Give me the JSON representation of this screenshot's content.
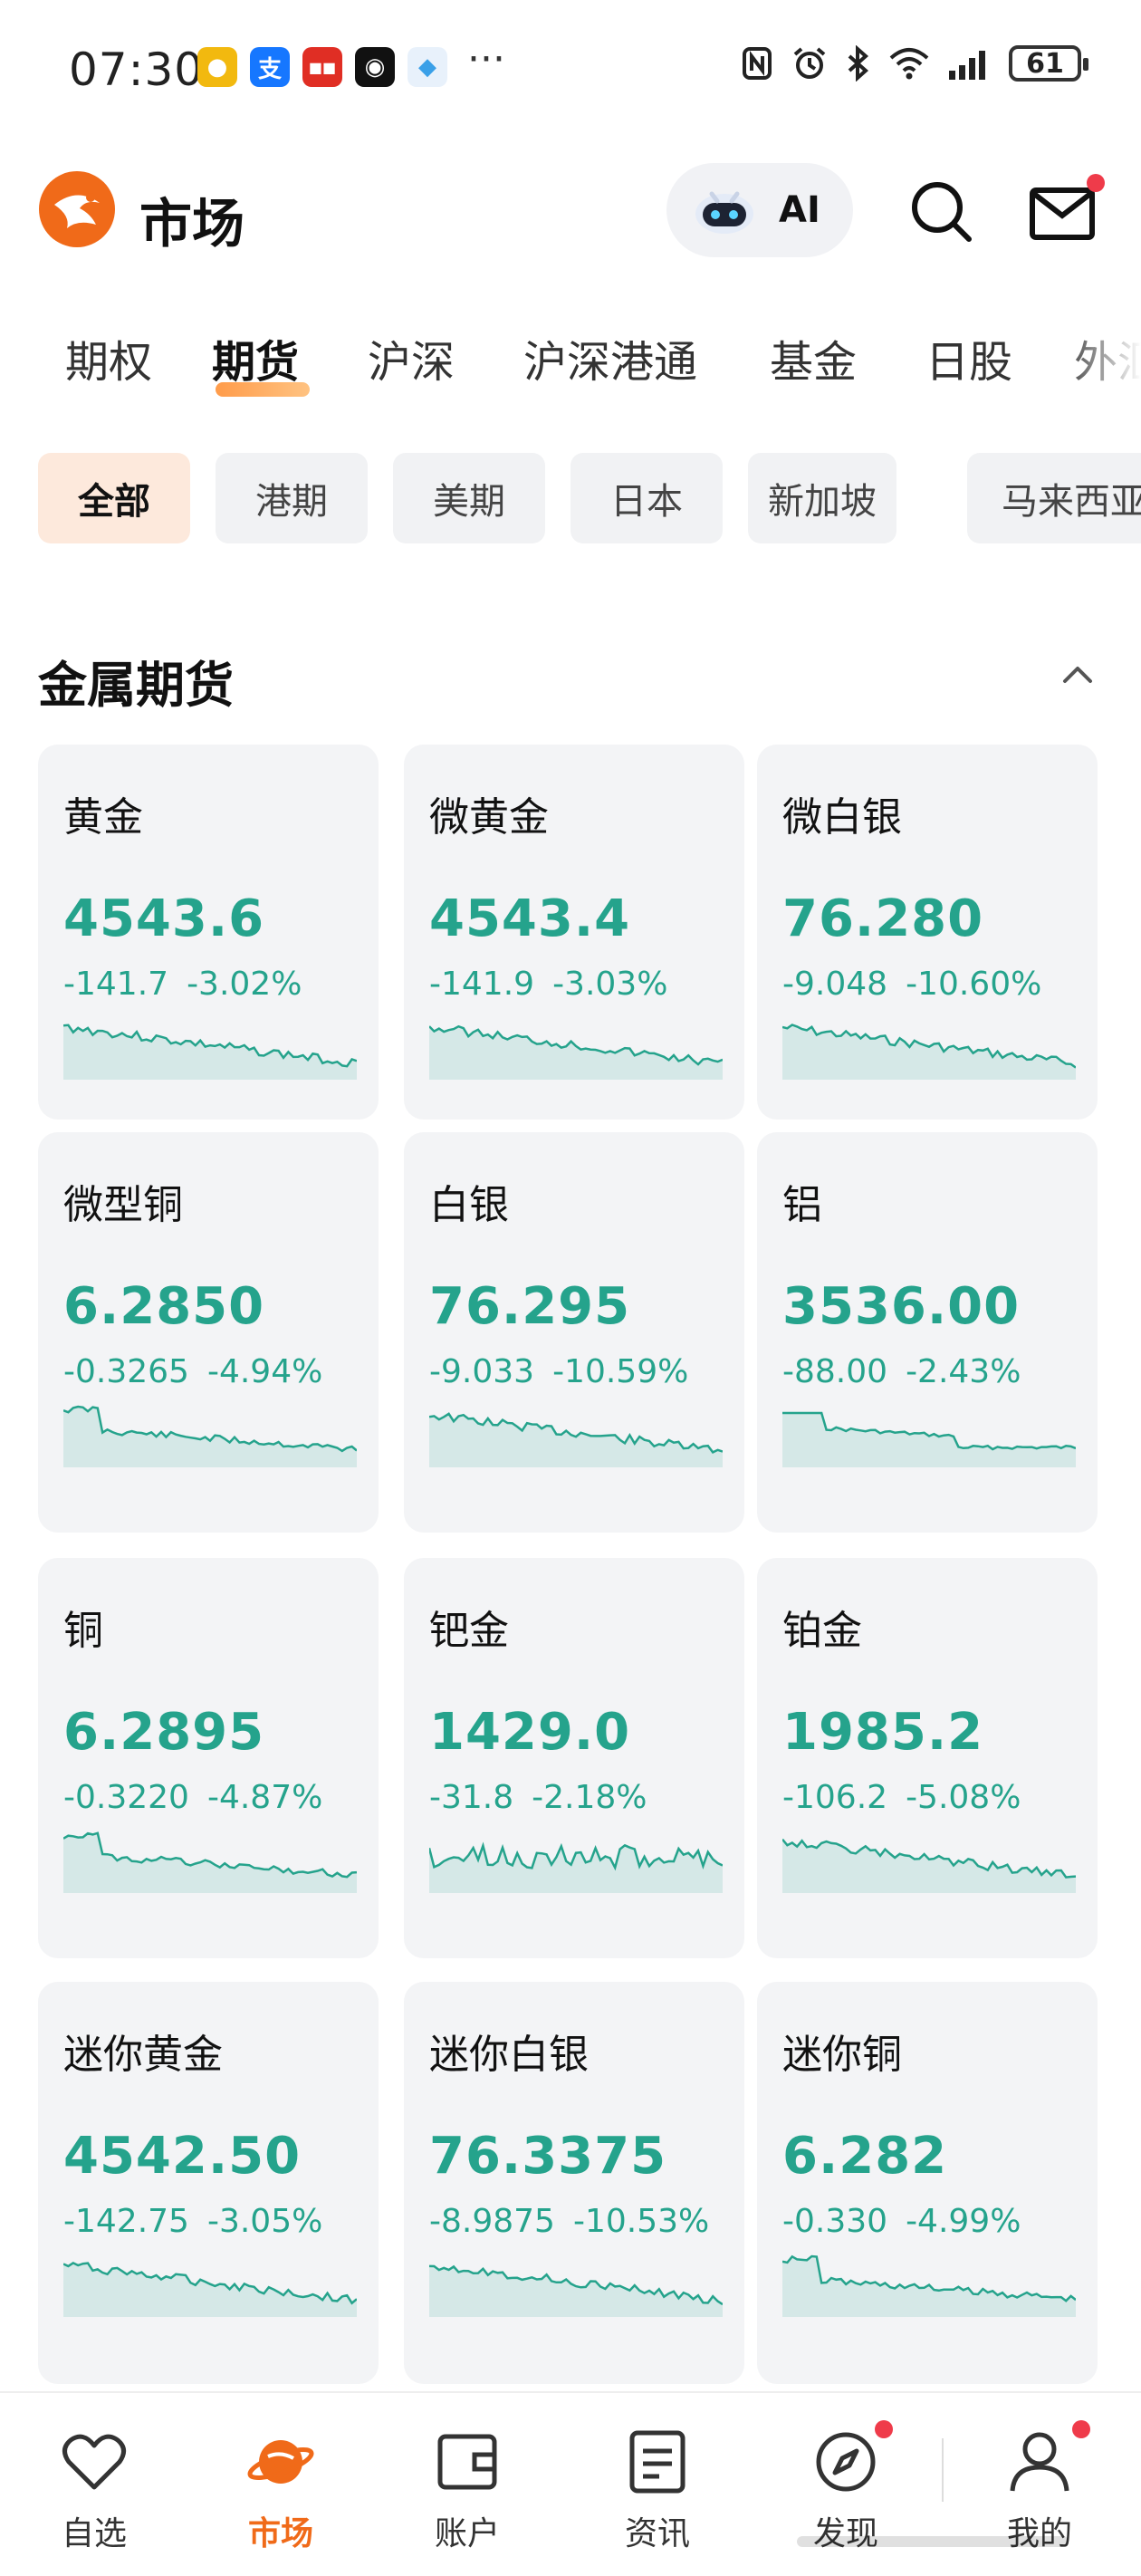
{
  "status_bar": {
    "time": "07:30",
    "battery": "61",
    "apps": [
      "weibo-icon",
      "alipay-icon",
      "news-icon",
      "camera-app-icon",
      "bubble-app-icon"
    ],
    "more": "···"
  },
  "header": {
    "title": "市场",
    "ai_label": "AI"
  },
  "tabs": [
    {
      "label": "期权",
      "active": false
    },
    {
      "label": "期货",
      "active": true
    },
    {
      "label": "沪深",
      "active": false
    },
    {
      "label": "沪深港通",
      "active": false
    },
    {
      "label": "基金",
      "active": false
    },
    {
      "label": "日股",
      "active": false
    },
    {
      "label": "外汇",
      "active": false
    }
  ],
  "chips": [
    {
      "label": "全部",
      "active": true
    },
    {
      "label": "港期",
      "active": false
    },
    {
      "label": "美期",
      "active": false
    },
    {
      "label": "日本",
      "active": false
    },
    {
      "label": "新加坡",
      "active": false
    },
    {
      "label": "马来西亚",
      "active": false
    }
  ],
  "section": {
    "title": "金属期货"
  },
  "cards": [
    {
      "name": "黄金",
      "price": "4543.6",
      "change": "-141.7",
      "pct": "-3.02%"
    },
    {
      "name": "微黄金",
      "price": "4543.4",
      "change": "-141.9",
      "pct": "-3.03%"
    },
    {
      "name": "微白银",
      "price": "76.280",
      "change": "-9.048",
      "pct": "-10.60%"
    },
    {
      "name": "微型铜",
      "price": "6.2850",
      "change": "-0.3265",
      "pct": "-4.94%"
    },
    {
      "name": "白银",
      "price": "76.295",
      "change": "-9.033",
      "pct": "-10.59%"
    },
    {
      "name": "铝",
      "price": "3536.00",
      "change": "-88.00",
      "pct": "-2.43%"
    },
    {
      "name": "铜",
      "price": "6.2895",
      "change": "-0.3220",
      "pct": "-4.87%"
    },
    {
      "name": "钯金",
      "price": "1429.0",
      "change": "-31.8",
      "pct": "-2.18%"
    },
    {
      "name": "铂金",
      "price": "1985.2",
      "change": "-106.2",
      "pct": "-5.08%"
    },
    {
      "name": "迷你黄金",
      "price": "4542.50",
      "change": "-142.75",
      "pct": "-3.05%"
    },
    {
      "name": "迷你白银",
      "price": "76.3375",
      "change": "-8.9875",
      "pct": "-10.53%"
    },
    {
      "name": "迷你铜",
      "price": "6.282",
      "change": "-0.330",
      "pct": "-4.99%"
    }
  ],
  "bottom_nav": [
    {
      "label": "自选",
      "icon": "heart-icon",
      "active": false
    },
    {
      "label": "市场",
      "icon": "planet-icon",
      "active": true
    },
    {
      "label": "账户",
      "icon": "wallet-icon",
      "active": false
    },
    {
      "label": "资讯",
      "icon": "news-icon",
      "active": false
    },
    {
      "label": "发现",
      "icon": "compass-icon",
      "active": false
    },
    {
      "label": "我的",
      "icon": "user-icon",
      "active": false
    }
  ],
  "colors": {
    "down": "#25a38c",
    "accent": "#f06a19",
    "badge": "#ef3b4a"
  }
}
